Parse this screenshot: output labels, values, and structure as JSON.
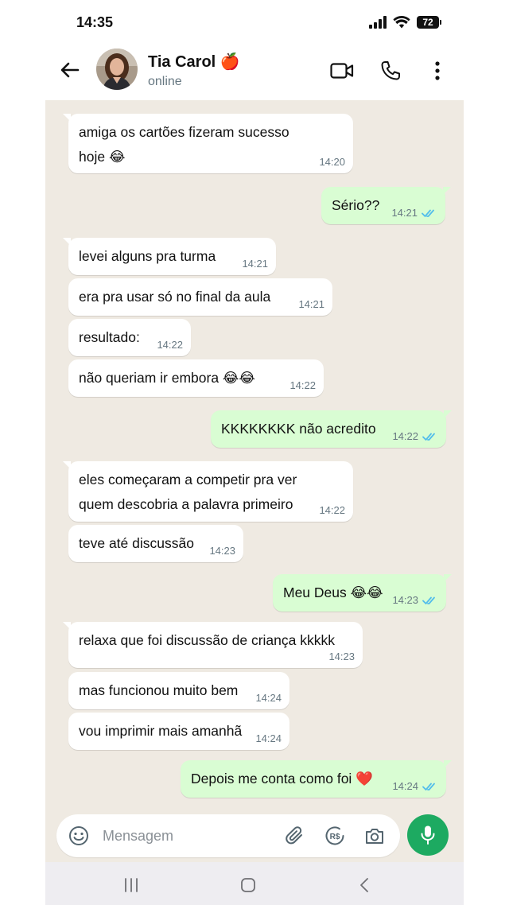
{
  "status_bar": {
    "time": "14:35",
    "battery": "72"
  },
  "header": {
    "contact_name": "Tia Carol",
    "contact_emoji": "🍎",
    "contact_status": "online"
  },
  "messages": [
    {
      "dir": "in",
      "lines": [
        "amiga os cartões fizeram sucesso",
        "hoje 😂"
      ],
      "time": "14:20"
    },
    {
      "dir": "out",
      "lines": [
        "Sério??"
      ],
      "time": "14:21",
      "read": true
    },
    {
      "dir": "in",
      "lines": [
        "levei alguns pra turma"
      ],
      "time": "14:21"
    },
    {
      "dir": "in",
      "lines": [
        "era pra usar só no final da aula"
      ],
      "time": "14:21"
    },
    {
      "dir": "in",
      "lines": [
        "resultado:"
      ],
      "time": "14:22"
    },
    {
      "dir": "in",
      "lines": [
        "não queriam ir embora 😂😂"
      ],
      "time": "14:22"
    },
    {
      "dir": "out",
      "lines": [
        "KKKKKKKK não acredito"
      ],
      "time": "14:22",
      "read": true
    },
    {
      "dir": "in",
      "lines": [
        "eles começaram a competir pra ver",
        "quem descobria a palavra primeiro"
      ],
      "time": "14:22"
    },
    {
      "dir": "in",
      "lines": [
        "teve até discussão"
      ],
      "time": "14:23"
    },
    {
      "dir": "out",
      "lines": [
        "Meu Deus 😂😂"
      ],
      "time": "14:23",
      "read": true
    },
    {
      "dir": "in",
      "lines": [
        "relaxa que foi discussão de criança kkkkk"
      ],
      "time": "14:23"
    },
    {
      "dir": "in",
      "lines": [
        "mas funcionou muito bem"
      ],
      "time": "14:24"
    },
    {
      "dir": "in",
      "lines": [
        "vou imprimir mais amanhã"
      ],
      "time": "14:24"
    },
    {
      "dir": "out",
      "lines": [
        "Depois me conta como foi ❤️"
      ],
      "time": "14:24",
      "read": true
    }
  ],
  "composer": {
    "placeholder": "Mensagem",
    "pix_label": "R$"
  },
  "colors": {
    "incoming": "#ffffff",
    "outgoing": "#d9fdd3",
    "tick_read": "#53bdeb",
    "mic": "#1daa61",
    "chat_bg": "#efeae2"
  }
}
